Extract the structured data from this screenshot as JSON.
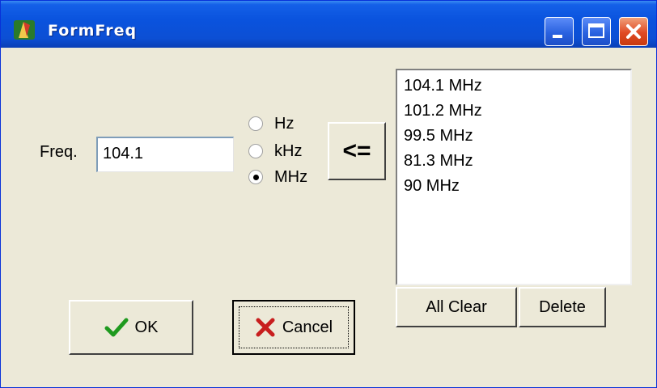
{
  "window": {
    "title": "FormFreq"
  },
  "form": {
    "freq_label": "Freq.",
    "freq_value": "104.1",
    "units": [
      {
        "label": "Hz",
        "checked": false
      },
      {
        "label": "kHz",
        "checked": false
      },
      {
        "label": "MHz",
        "checked": true
      }
    ],
    "add_button_label": "<="
  },
  "list": {
    "items": [
      "104.1 MHz",
      "101.2 MHz",
      "99.5 MHz",
      "81.3 MHz",
      "90 MHz"
    ],
    "all_clear_label": "All Clear",
    "delete_label": "Delete"
  },
  "buttons": {
    "ok_label": "OK",
    "cancel_label": "Cancel"
  },
  "colors": {
    "titlebar": "#0a53de",
    "window_bg": "#ece9d8",
    "close_button": "#e04a24",
    "ok_icon": "#1f9a1f",
    "cancel_icon": "#c81e1e"
  },
  "icons": {
    "app": "app-icon",
    "minimize": "minimize-icon",
    "maximize": "maximize-icon",
    "close": "close-icon",
    "ok": "checkmark-icon",
    "cancel": "x-icon"
  }
}
